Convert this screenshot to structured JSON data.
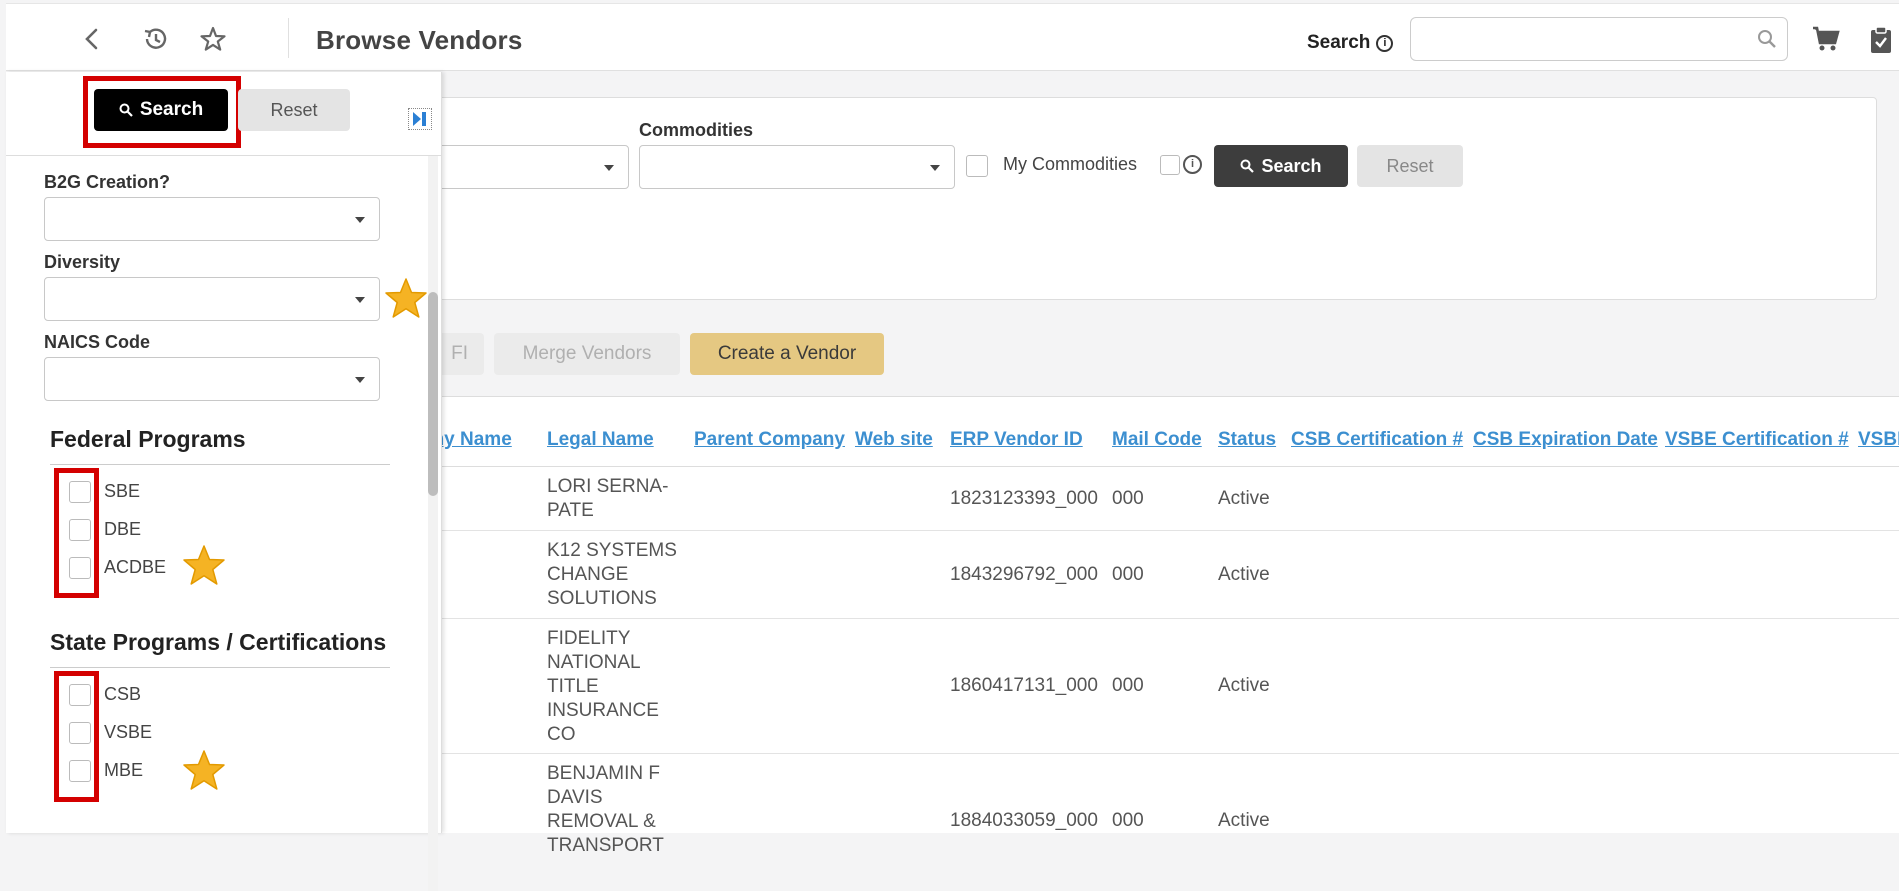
{
  "header": {
    "title": "Browse Vendors",
    "search_label": "Search",
    "search_value": "",
    "icons": [
      "back-arrow-icon",
      "history-icon",
      "star-icon",
      "search-icon",
      "cart-icon",
      "clipboard-icon"
    ]
  },
  "criteria": {
    "commodities_label": "Commodities",
    "my_commodities_label": "My Commodities",
    "search_button": "Search",
    "reset_button": "Reset"
  },
  "actions": {
    "partial_button": "FI",
    "merge_button": "Merge Vendors",
    "create_button": "Create a Vendor"
  },
  "table": {
    "columns": [
      "any Name",
      "Legal Name",
      "Parent Company",
      "Web site",
      "ERP Vendor ID",
      "Mail Code",
      "Status",
      "CSB Certification #",
      "CSB Expiration Date",
      "VSBE Certification #",
      "VSBE"
    ],
    "rows": [
      {
        "legal_name": [
          "LORI SERNA-",
          "PATE"
        ],
        "erp_id": "1823123393_000",
        "mail_code": "000",
        "status": "Active"
      },
      {
        "legal_name": [
          "K12 SYSTEMS",
          "CHANGE",
          "SOLUTIONS"
        ],
        "erp_id": "1843296792_000",
        "mail_code": "000",
        "status": "Active"
      },
      {
        "legal_name": [
          "FIDELITY",
          "NATIONAL",
          "TITLE",
          "INSURANCE",
          "CO"
        ],
        "erp_id": "1860417131_000",
        "mail_code": "000",
        "status": "Active"
      },
      {
        "legal_name": [
          "BENJAMIN F",
          "DAVIS",
          "REMOVAL &",
          "TRANSPORT"
        ],
        "erp_id": "1884033059_000",
        "mail_code": "000",
        "status": "Active"
      }
    ]
  },
  "panel": {
    "search_button": "Search",
    "reset_button": "Reset",
    "b2g_label": "B2G Creation?",
    "diversity_label": "Diversity",
    "naics_label": "NAICS Code",
    "federal_title": "Federal Programs",
    "federal_items": [
      "SBE",
      "DBE",
      "ACDBE"
    ],
    "state_title": "State Programs / Certifications",
    "state_items": [
      "CSB",
      "VSBE",
      "MBE"
    ]
  },
  "colors": {
    "link": "#3c8fd0",
    "highlight": "#d40000",
    "star": "#f5b324",
    "create_button": "#e5c882"
  }
}
